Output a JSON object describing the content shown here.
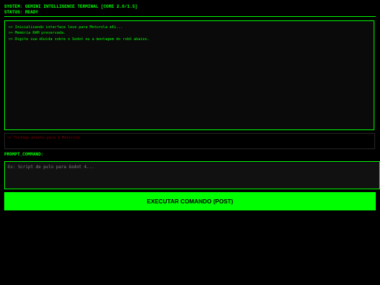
{
  "header": {
    "system_line": "SYSTEM: GEMINI INTELLIGENCE TERMINAL [CORE 2.0/1.5]",
    "status_line": "STATUS: READY"
  },
  "console": {
    "lines": [
      ">> Inicializando interface leve para Motorola e6i...",
      ">> Memória RAM preservada.",
      ">> Digite sua dúvida sobre o Godot ou a montagem do robô abaixo."
    ]
  },
  "error": {
    "text": ">> Tráfego pronto para 1 Motorola"
  },
  "prompt": {
    "label": "PROMPT_COMMAND:",
    "placeholder": "Ex: Script de pulo para Godot 4..."
  },
  "actions": {
    "execute_label": "EXECUTAR COMANDO (POST)"
  },
  "colors": {
    "background": "#000000",
    "accent": "#00ff00",
    "error": "#880000",
    "placeholder": "#808080"
  }
}
